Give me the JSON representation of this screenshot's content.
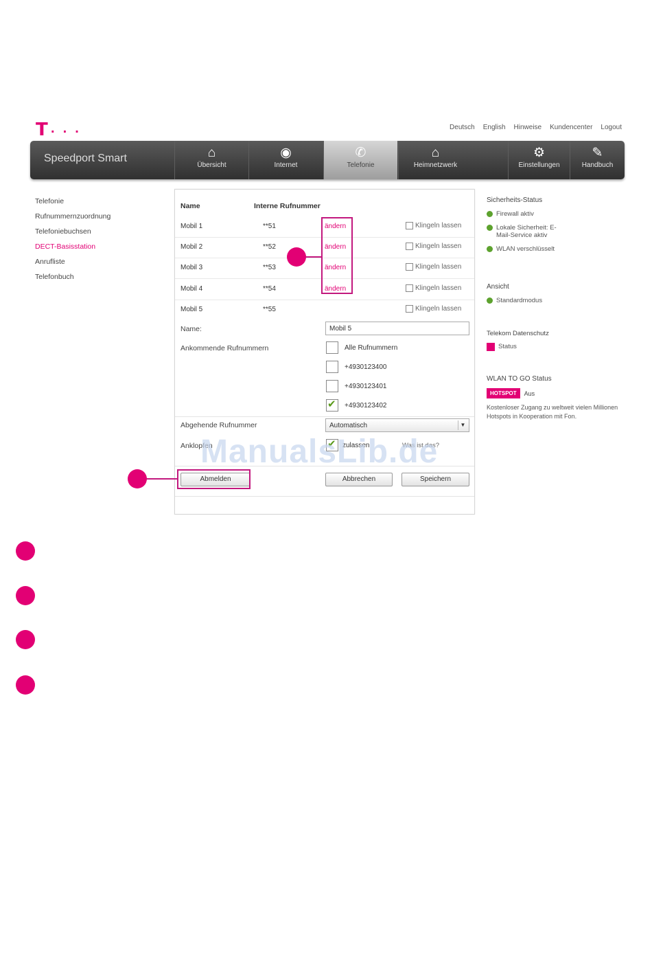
{
  "logo": {
    "letter": "T",
    "dots": "· · ·"
  },
  "top_links": [
    "Deutsch",
    "English",
    "Hinweise",
    "Kundencenter",
    "Logout"
  ],
  "navbar": {
    "brand": "Speedport Smart",
    "items": [
      {
        "label": "Übersicht",
        "icon": "home-icon",
        "glyph": "⌂"
      },
      {
        "label": "Internet",
        "icon": "globe-icon",
        "glyph": "◉"
      },
      {
        "label": "Telefonie",
        "icon": "phone-icon",
        "glyph": "✆"
      },
      {
        "label": "Heimnetzwerk",
        "icon": "house-network-icon",
        "glyph": "⌂"
      },
      {
        "label": "Einstellungen",
        "icon": "gear-icon",
        "glyph": "⚙"
      },
      {
        "label": "Handbuch",
        "icon": "book-icon",
        "glyph": "✎"
      }
    ],
    "active_index": 2
  },
  "sidebar": {
    "items": [
      "Telefonie",
      "Rufnummernzuordnung",
      "Telefoniebuchsen",
      "DECT-Basisstation",
      "Anrufliste",
      "Telefonbuch"
    ],
    "selected_index": 3
  },
  "table": {
    "headers": {
      "name": "Name",
      "internal": "Interne Rufnummer"
    },
    "rows": [
      {
        "name": "Mobil 1",
        "internal": "**51",
        "action": "ändern",
        "ring_label": "Klingeln lassen"
      },
      {
        "name": "Mobil 2",
        "internal": "**52",
        "action": "ändern",
        "ring_label": "Klingeln lassen"
      },
      {
        "name": "Mobil 3",
        "internal": "**53",
        "action": "ändern",
        "ring_label": "Klingeln lassen"
      },
      {
        "name": "Mobil 4",
        "internal": "**54",
        "action": "ändern",
        "ring_label": "Klingeln lassen"
      },
      {
        "name": "Mobil 5",
        "internal": "**55",
        "action": "",
        "ring_label": "Klingeln lassen"
      }
    ]
  },
  "form": {
    "name_label": "Name:",
    "name_value": "Mobil 5",
    "incoming_label": "Ankommende Rufnummern",
    "incoming_options": [
      {
        "label": "Alle Rufnummern",
        "checked": false
      },
      {
        "label": "+4930123400",
        "checked": false
      },
      {
        "label": "+4930123401",
        "checked": false
      },
      {
        "label": "+4930123402",
        "checked": true
      }
    ],
    "outgoing_label": "Abgehende Rufnummer",
    "outgoing_value": "Automatisch",
    "callwaiting_label": "Anklopfen",
    "callwaiting_option": "zulassen",
    "callwaiting_checked": true,
    "help_link": "Was ist das?",
    "deregister_button": "Abmelden",
    "cancel_button": "Abbrechen",
    "save_button": "Speichern"
  },
  "status": {
    "security_title": "Sicherheits-Status",
    "security_items": [
      "Firewall aktiv",
      "Lokale Sicherheit: E-Mail-Service aktiv",
      "WLAN verschlüsselt"
    ],
    "view_title": "Ansicht",
    "view_items": [
      "Standardmodus"
    ],
    "telekom_title": "Telekom Datenschutz",
    "telekom_items": [
      "Status"
    ],
    "wlan_title": "WLAN TO GO Status",
    "hotspot_badge": "HOTSPOT",
    "hotspot_state": "Aus",
    "hotspot_desc": "Kostenloser Zugang zu weltweit vielen Millionen Hotspots in Kooperation mit Fon."
  },
  "watermark": "ManualsLib.de",
  "colors": {
    "accent": "#e20074",
    "callout": "#c2187e",
    "ok": "#5da22e"
  }
}
